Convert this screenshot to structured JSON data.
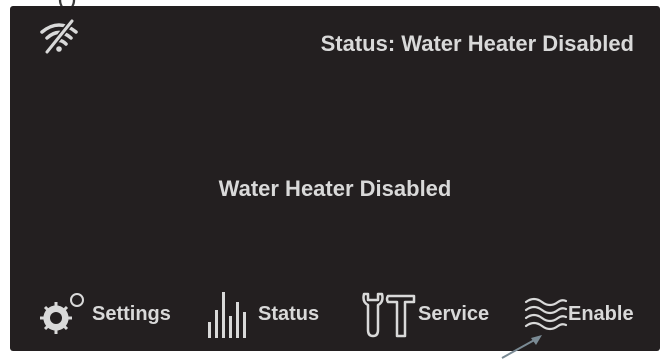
{
  "fragment_text": "(    )",
  "screen": {
    "status_text": "Status: Water Heater Disabled",
    "center_message": "Water Heater Disabled"
  },
  "nav": {
    "settings_label": "Settings",
    "status_label": "Status",
    "service_label": "Service",
    "enable_label": "Enable"
  },
  "colors": {
    "screen_bg": "#231f20",
    "text": "#d9d9d9",
    "arrow": "#7a8a94"
  },
  "icons": [
    "wifi-off-icon",
    "gear-icon",
    "bar-chart-icon",
    "wrench-hammer-icon",
    "waves-icon",
    "pointer-arrow-icon"
  ]
}
